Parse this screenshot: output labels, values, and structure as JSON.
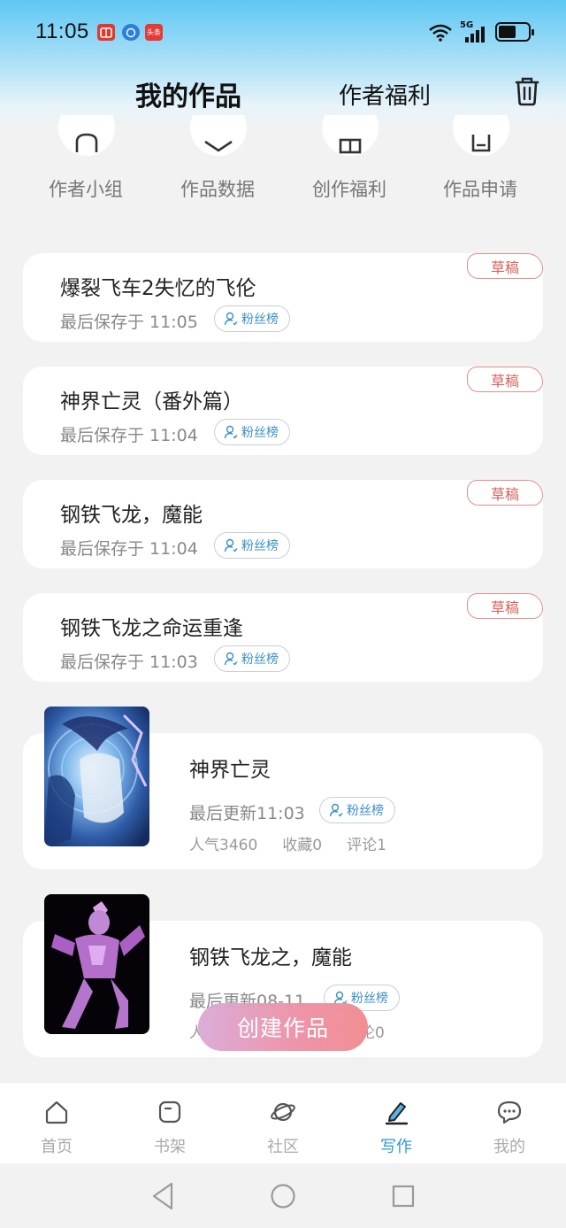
{
  "status_bar": {
    "time": "11:05",
    "app_badge_text": "头条",
    "network": "5G"
  },
  "header": {
    "tab_works": "我的作品",
    "tab_welfare": "作者福利"
  },
  "quick_entries": [
    {
      "label": "作者小组",
      "icon": "group-icon"
    },
    {
      "label": "作品数据",
      "icon": "data-icon"
    },
    {
      "label": "创作福利",
      "icon": "gift-icon"
    },
    {
      "label": "作品申请",
      "icon": "apply-icon"
    }
  ],
  "drafts": [
    {
      "title": "爆裂飞车2失忆的飞伦",
      "saved": "最后保存于 11:05",
      "badge": "粉丝榜",
      "tag": "草稿"
    },
    {
      "title": "神界亡灵（番外篇）",
      "saved": "最后保存于 11:04",
      "badge": "粉丝榜",
      "tag": "草稿"
    },
    {
      "title": "钢铁飞龙，魔能",
      "saved": "最后保存于 11:04",
      "badge": "粉丝榜",
      "tag": "草稿"
    },
    {
      "title": "钢铁飞龙之命运重逢",
      "saved": "最后保存于 11:03",
      "badge": "粉丝榜",
      "tag": "草稿"
    }
  ],
  "published": [
    {
      "title": "神界亡灵",
      "updated": "最后更新11:03",
      "badge": "粉丝榜",
      "popularity": "人气3460",
      "favorites": "收藏0",
      "comments": "评论1"
    },
    {
      "title": "钢铁飞龙之，魔能",
      "updated": "最后更新08-11",
      "badge": "粉丝榜",
      "popularity": "人",
      "comments": "论0"
    }
  ],
  "create_button": "创建作品",
  "bottom_nav": [
    {
      "label": "首页",
      "icon": "home-icon",
      "active": false
    },
    {
      "label": "书架",
      "icon": "bookshelf-icon",
      "active": false
    },
    {
      "label": "社区",
      "icon": "planet-icon",
      "active": false
    },
    {
      "label": "写作",
      "icon": "write-icon",
      "active": true
    },
    {
      "label": "我的",
      "icon": "chat-icon",
      "active": false
    }
  ],
  "colors": {
    "accent": "#2a9ad4",
    "draft_tag": "#d9625a",
    "create_gradient_start": "#d9a9d7",
    "create_gradient_end": "#f08a8e"
  }
}
